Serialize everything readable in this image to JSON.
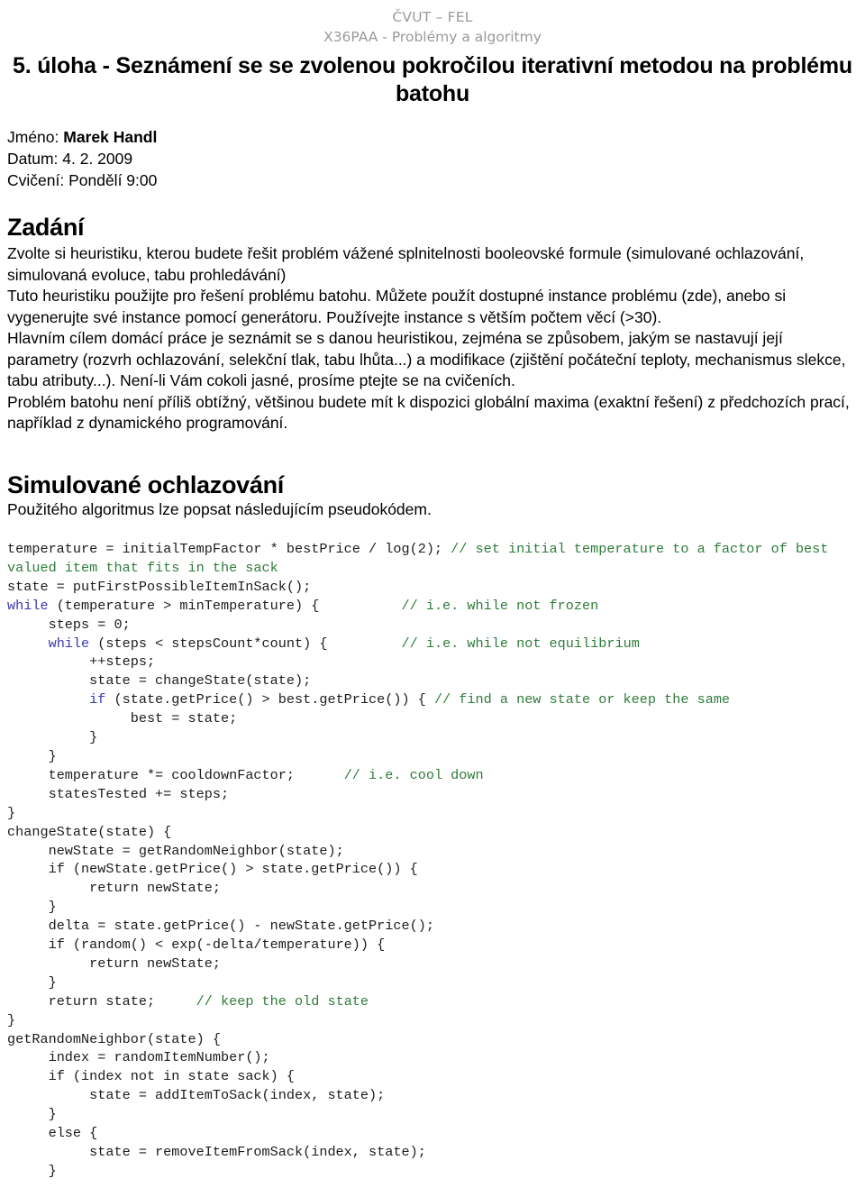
{
  "header": {
    "line1": "ČVUT – FEL",
    "line2": "X36PAA - Problémy a algoritmy"
  },
  "title": "5. úloha - Seznámení se se zvolenou pokročilou iterativní metodou na problému batohu",
  "meta": {
    "name_label": "Jméno:",
    "name_value": "Marek Handl",
    "date_line": "Datum: 4. 2. 2009",
    "exercise_line": "Cvičení: Pondělí 9:00"
  },
  "assignment": {
    "heading": "Zadání",
    "paragraphs": [
      "Zvolte si heuristiku, kterou budete řešit problém vážené splnitelnosti booleovské formule (simulované ochlazování, simulovaná evoluce, tabu prohledávání)",
      "Tuto heuristiku použijte pro řešení problému batohu. Můžete použít dostupné instance problému (zde), anebo si vygenerujte své instance pomocí generátoru. Používejte instance s větším počtem věcí (>30).",
      "Hlavním cílem domácí práce je seznámit se s danou heuristikou, zejména se způsobem, jakým se nastavují její parametry (rozvrh ochlazování, selekční tlak, tabu lhůta...) a modifikace (zjištění počáteční teploty, mechanismus slekce, tabu atributy...). Není-li Vám cokoli jasné, prosíme ptejte se na cvičeních.",
      "Problém batohu není příliš obtížný, většinou budete mít k dispozici globální maxima (exaktní řešení) z předchozích prací, například z dynamického programování."
    ]
  },
  "annealing": {
    "heading": "Simulované ochlazování",
    "intro": "Použitého algoritmus lze popsat následujícím pseudokódem."
  },
  "pseudocode": {
    "lines": [
      [
        {
          "t": "temperature = initialTempFactor * bestPrice / log(2); ",
          "s": "plain"
        },
        {
          "t": "// set initial temperature to a factor of best valued item that fits in the sack",
          "s": "cmt"
        }
      ],
      [
        {
          "t": "state = putFirstPossibleItemInSack();",
          "s": "plain"
        }
      ],
      [
        {
          "t": "while",
          "s": "kw"
        },
        {
          "t": " (temperature > minTemperature) {          ",
          "s": "plain"
        },
        {
          "t": "// i.e. while not frozen",
          "s": "cmt"
        }
      ],
      [
        {
          "t": "     steps = 0;",
          "s": "plain"
        }
      ],
      [
        {
          "t": "     ",
          "s": "plain"
        },
        {
          "t": "while",
          "s": "kw"
        },
        {
          "t": " (steps < stepsCount*count) {         ",
          "s": "plain"
        },
        {
          "t": "// i.e. while not equilibrium",
          "s": "cmt"
        }
      ],
      [
        {
          "t": "          ++steps;",
          "s": "plain"
        }
      ],
      [
        {
          "t": "          state = changeState(state);",
          "s": "plain"
        }
      ],
      [
        {
          "t": "          ",
          "s": "plain"
        },
        {
          "t": "if",
          "s": "kw"
        },
        {
          "t": " (state.getPrice() > best.getPrice()) { ",
          "s": "plain"
        },
        {
          "t": "// find a new state or keep the same",
          "s": "cmt"
        }
      ],
      [
        {
          "t": "               best = state;",
          "s": "plain"
        }
      ],
      [
        {
          "t": "          }",
          "s": "plain"
        }
      ],
      [
        {
          "t": "     }",
          "s": "plain"
        }
      ],
      [
        {
          "t": "     temperature *= cooldownFactor;      ",
          "s": "plain"
        },
        {
          "t": "// i.e. cool down",
          "s": "cmt"
        }
      ],
      [
        {
          "t": "     statesTested += steps;",
          "s": "plain"
        }
      ],
      [
        {
          "t": "}",
          "s": "plain"
        }
      ],
      [
        {
          "t": "changeState(state) {",
          "s": "plain"
        }
      ],
      [
        {
          "t": "     newState = getRandomNeighbor(state);",
          "s": "plain"
        }
      ],
      [
        {
          "t": "     if (newState.getPrice() > state.getPrice()) {",
          "s": "plain"
        }
      ],
      [
        {
          "t": "          return newState;",
          "s": "plain"
        }
      ],
      [
        {
          "t": "     }",
          "s": "plain"
        }
      ],
      [
        {
          "t": "     delta = state.getPrice() - newState.getPrice();",
          "s": "plain"
        }
      ],
      [
        {
          "t": "     if (random() < exp(-delta/temperature)) {",
          "s": "plain"
        }
      ],
      [
        {
          "t": "          return newState;",
          "s": "plain"
        }
      ],
      [
        {
          "t": "     }",
          "s": "plain"
        }
      ],
      [
        {
          "t": "     return state;     ",
          "s": "plain"
        },
        {
          "t": "// keep the old state",
          "s": "cmt"
        }
      ],
      [
        {
          "t": "}",
          "s": "plain"
        }
      ],
      [
        {
          "t": "getRandomNeighbor(state) {",
          "s": "plain"
        }
      ],
      [
        {
          "t": "     index = randomItemNumber();",
          "s": "plain"
        }
      ],
      [
        {
          "t": "     if (index not in state sack) {",
          "s": "plain"
        }
      ],
      [
        {
          "t": "          state = addItemToSack(index, state);",
          "s": "plain"
        }
      ],
      [
        {
          "t": "     }",
          "s": "plain"
        }
      ],
      [
        {
          "t": "     else {",
          "s": "plain"
        }
      ],
      [
        {
          "t": "          state = removeItemFromSack(index, state);",
          "s": "plain"
        }
      ],
      [
        {
          "t": "     }",
          "s": "plain"
        }
      ]
    ]
  },
  "colors": {
    "header_gray": "#9a9a9a",
    "comment_green": "#2f7c3b",
    "keyword_blue": "#3a3ab0",
    "body_text": "#000000",
    "page_background": "#ffffff"
  }
}
